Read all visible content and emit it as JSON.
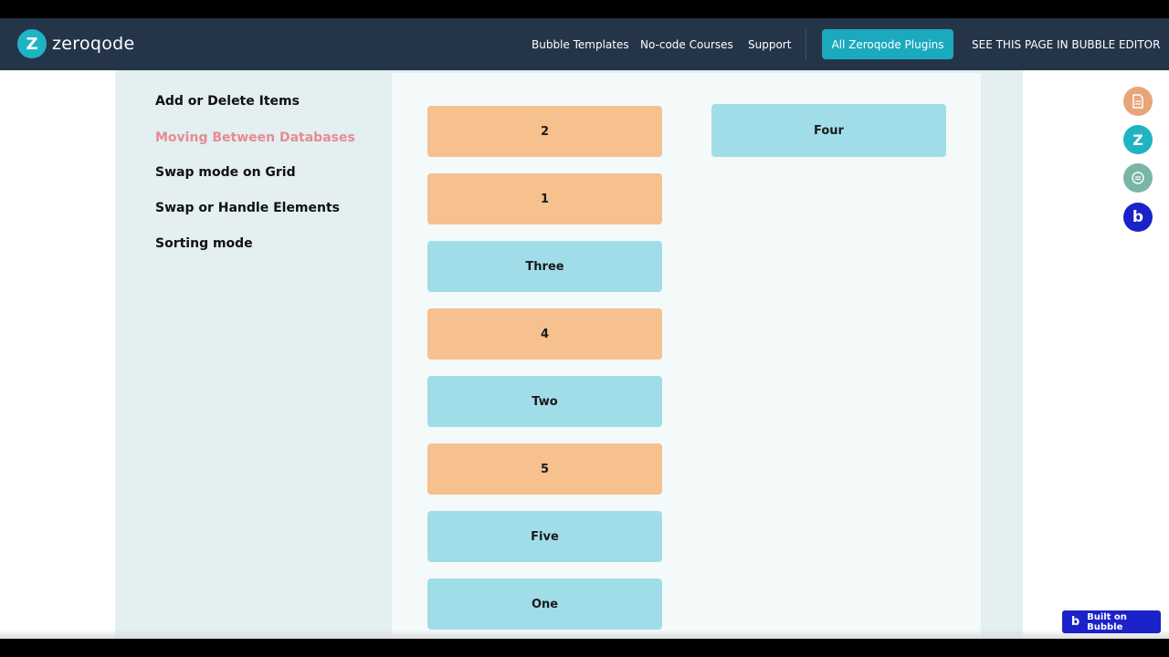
{
  "header": {
    "logo_text": "zeroqode",
    "logo_mark": "Z",
    "nav": [
      "Bubble Templates",
      "No-code Courses",
      "Support"
    ],
    "plugins_button": "All Zeroqode Plugins",
    "editor_link": "SEE THIS PAGE IN BUBBLE EDITOR"
  },
  "sidebar": {
    "items": [
      {
        "label": "Add or Delete Items",
        "active": false
      },
      {
        "label": "Moving Between Databases",
        "active": true
      },
      {
        "label": "Swap mode on Grid",
        "active": false
      },
      {
        "label": "Swap or Handle Elements",
        "active": false
      },
      {
        "label": "Sorting mode",
        "active": false
      }
    ]
  },
  "list_left": [
    {
      "label": "2",
      "color": "orange"
    },
    {
      "label": "1",
      "color": "orange"
    },
    {
      "label": "Three",
      "color": "blue"
    },
    {
      "label": "4",
      "color": "orange"
    },
    {
      "label": "Two",
      "color": "blue"
    },
    {
      "label": "5",
      "color": "orange"
    },
    {
      "label": "Five",
      "color": "blue"
    },
    {
      "label": "One",
      "color": "blue"
    }
  ],
  "list_right": [
    {
      "label": "Four",
      "color": "blue"
    }
  ],
  "floating_icons": [
    {
      "name": "document-icon",
      "color": "#e7a57a"
    },
    {
      "name": "zeroqode-icon",
      "color": "#1fb3c4"
    },
    {
      "name": "chat-icon",
      "color": "#7ab6a6"
    },
    {
      "name": "bubble-icon",
      "color": "#1b22c9"
    }
  ],
  "badge": {
    "label": "Built on Bubble",
    "logo": "b"
  },
  "colors": {
    "header_bg": "#253549",
    "accent": "#1ba9bd",
    "orange_card": "#f6c08f",
    "blue_card": "#a1dde9",
    "active_item": "#e88a93"
  }
}
